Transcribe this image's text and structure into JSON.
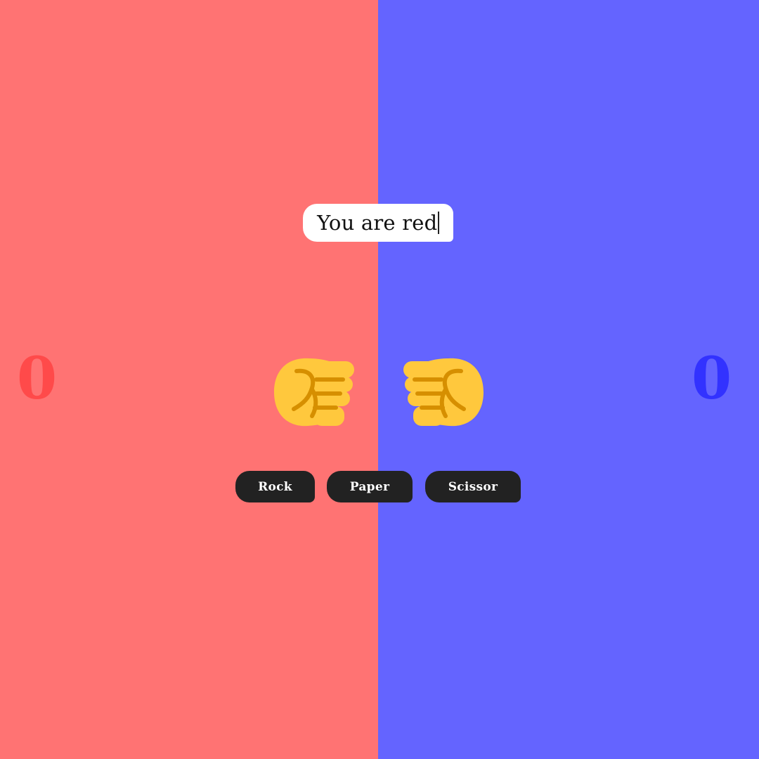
{
  "colors": {
    "red_side": "#ff7373",
    "blue_side": "#6464ff",
    "red_score": "#ff4a4a",
    "blue_score": "#3232ff",
    "button_bg": "#222222",
    "fist": "#ffc83d",
    "fist_shade": "#d68f00"
  },
  "status": {
    "message": "You are red"
  },
  "players": {
    "red": {
      "score": "0",
      "hand_icon": "fist-right-icon"
    },
    "blue": {
      "score": "0",
      "hand_icon": "fist-left-icon"
    }
  },
  "controls": {
    "rock_label": "Rock",
    "paper_label": "Paper",
    "scissor_label": "Scissor"
  }
}
